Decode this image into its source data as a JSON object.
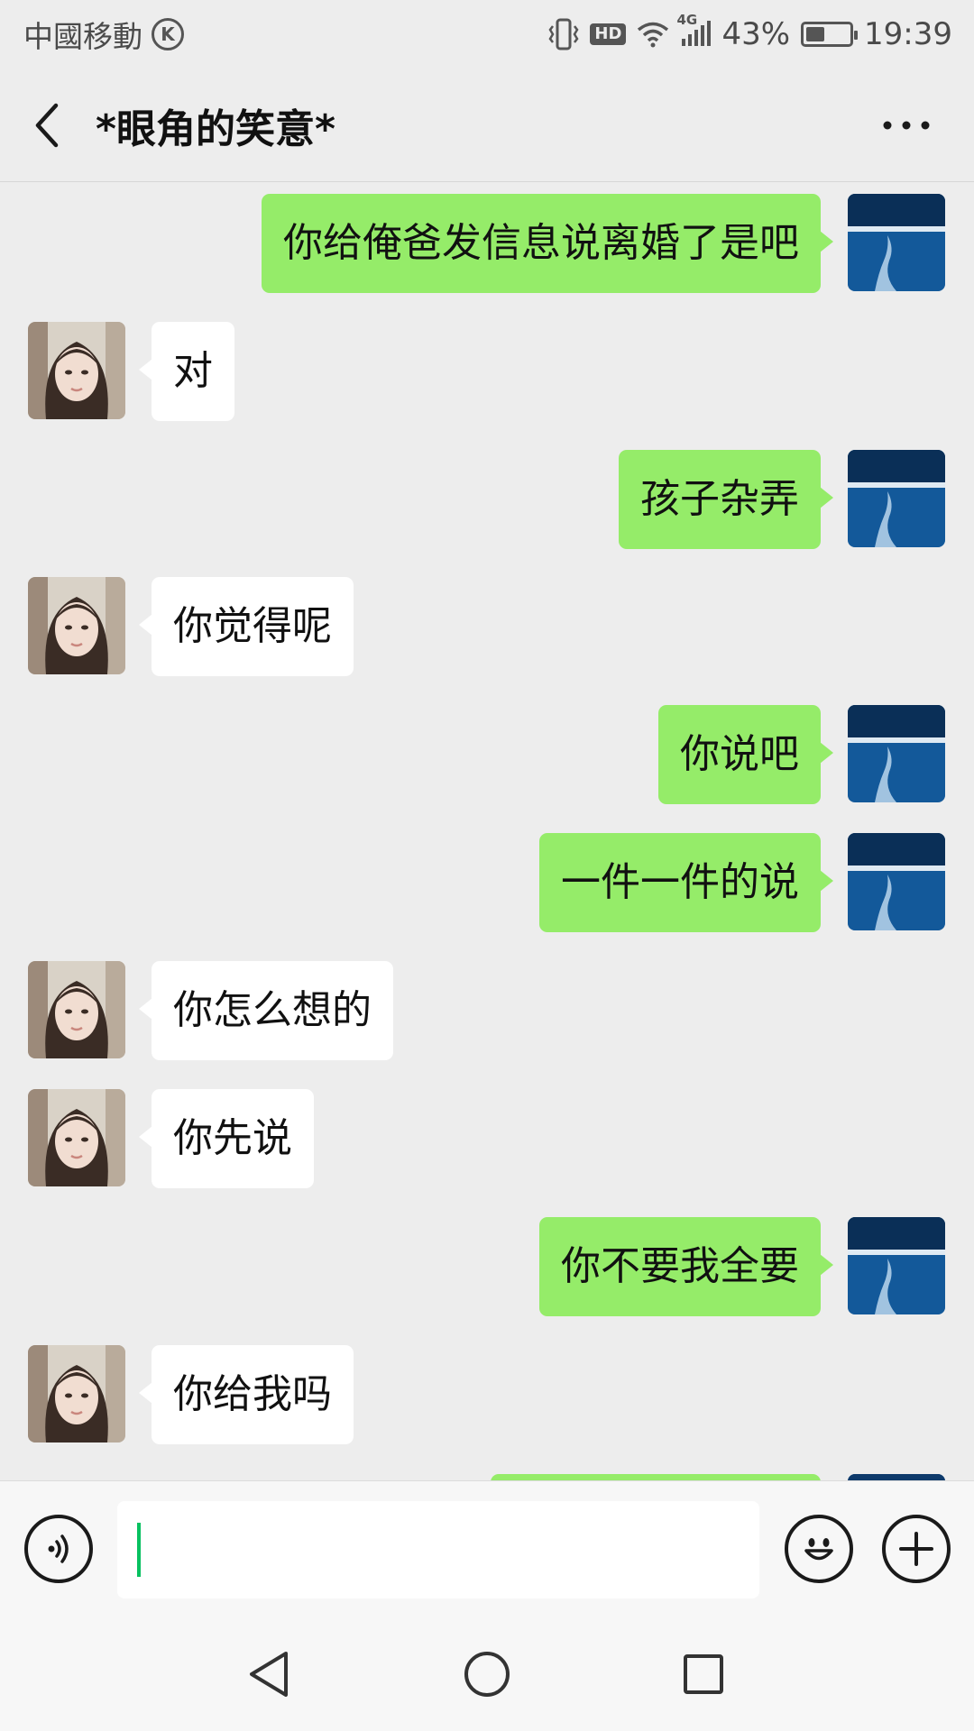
{
  "status_bar": {
    "carrier": "中國移動",
    "carrier_badge": "K",
    "hd": "HD",
    "network": "4G",
    "battery_text": "43%",
    "battery_level": 0.43,
    "time": "19:39"
  },
  "header": {
    "title": "*眼角的笑意*",
    "back_icon": "chevron-left-icon",
    "more_icon": "more-dots-icon"
  },
  "messages": [
    {
      "from": "self",
      "text": "你给俺爸发信息说离婚了是吧"
    },
    {
      "from": "other",
      "text": "对"
    },
    {
      "from": "self",
      "text": "孩子杂弄"
    },
    {
      "from": "other",
      "text": "你觉得呢"
    },
    {
      "from": "self",
      "text": "你说吧"
    },
    {
      "from": "self",
      "text": "一件一件的说"
    },
    {
      "from": "other",
      "text": "你怎么想的"
    },
    {
      "from": "other",
      "text": "你先说"
    },
    {
      "from": "self",
      "text": "你不要我全要"
    },
    {
      "from": "other",
      "text": "你给我吗"
    }
  ],
  "input_bar": {
    "voice_icon": "voice-icon",
    "text_value": "",
    "emoji_icon": "emoji-icon",
    "plus_icon": "plus-icon"
  },
  "colors": {
    "self_bubble": "#95ec69",
    "other_bubble": "#ffffff",
    "background": "#ededed",
    "caret": "#07c160"
  }
}
